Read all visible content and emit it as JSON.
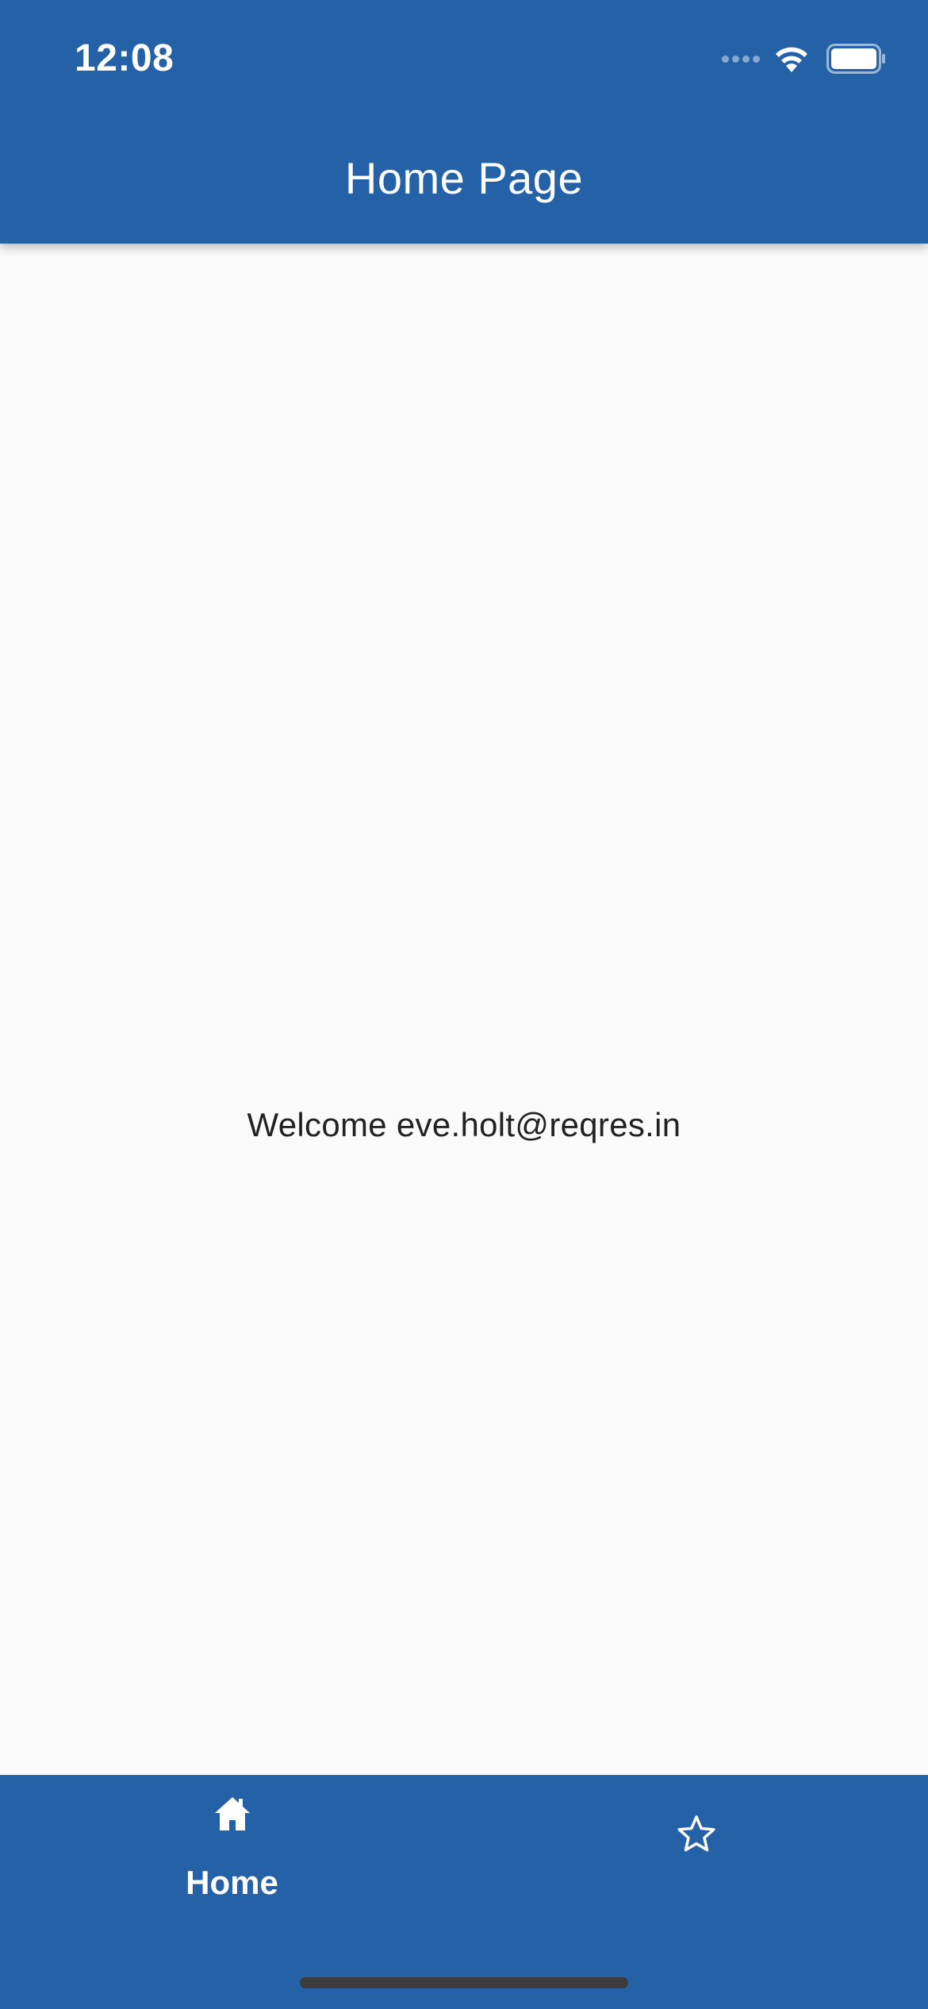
{
  "status_bar": {
    "time": "12:08"
  },
  "app_bar": {
    "title": "Home Page"
  },
  "main": {
    "welcome": "Welcome eve.holt@reqres.in"
  },
  "bottom_nav": {
    "items": [
      {
        "label": "Home",
        "icon": "home-icon",
        "selected": true
      },
      {
        "label": "",
        "icon": "star-outline-icon",
        "selected": false
      }
    ]
  },
  "colors": {
    "primary": "#2561a6",
    "background": "#fafafa",
    "on_primary": "#ffffff",
    "body_text": "#222222"
  }
}
